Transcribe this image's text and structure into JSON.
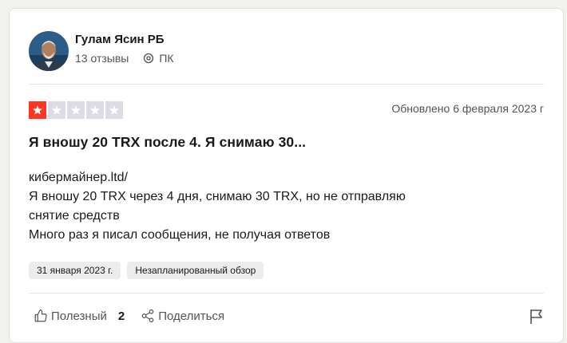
{
  "reviewer": {
    "name": "Гулам Ясин РБ",
    "reviews_count": "13 отзывы",
    "location": "ПК"
  },
  "review": {
    "rating": 1,
    "max_rating": 5,
    "updated": "Обновлено 6 февраля 2023 г",
    "title": "Я вношу 20 TRX после 4. Я снимаю 30...",
    "body_lines": [
      "кибермайнер.ltd/",
      "Я вношу 20 TRX через 4 дня, снимаю 30 TRX, но не отправляю",
      "снятие средств",
      "Много раз я писал сообщения, не получая ответов"
    ],
    "tags": [
      "31 января 2023 г.",
      "Незапланированный обзор"
    ]
  },
  "actions": {
    "useful_label": "Полезный",
    "useful_count": "2",
    "share_label": "Поделиться"
  },
  "colors": {
    "star_on": "#ff3722",
    "star_off": "#dcdce6"
  },
  "icons": {
    "location": "location-pin-icon",
    "useful": "thumbs-up-icon",
    "share": "share-icon",
    "flag": "flag-icon",
    "star": "star-icon"
  }
}
